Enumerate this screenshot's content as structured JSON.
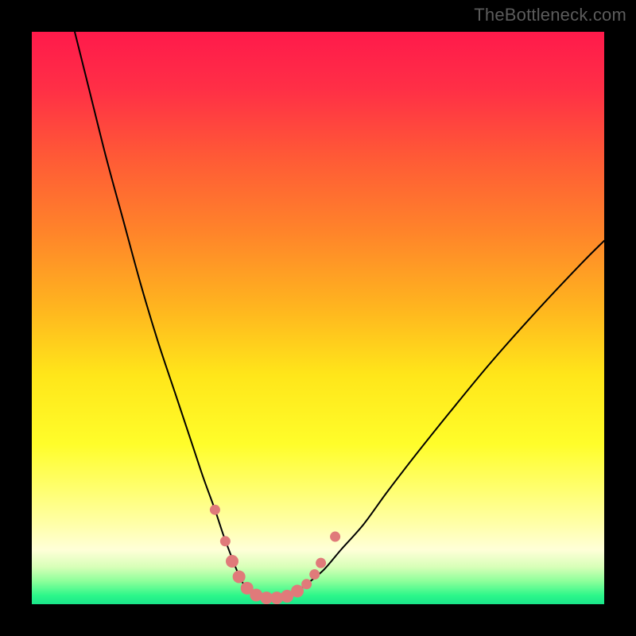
{
  "watermark": "TheBottleneck.com",
  "gradient": {
    "stops": [
      {
        "offset": 0.0,
        "color": "#ff1a4b"
      },
      {
        "offset": 0.1,
        "color": "#ff2f46"
      },
      {
        "offset": 0.22,
        "color": "#ff5a36"
      },
      {
        "offset": 0.35,
        "color": "#ff842a"
      },
      {
        "offset": 0.48,
        "color": "#ffb41f"
      },
      {
        "offset": 0.6,
        "color": "#ffe61a"
      },
      {
        "offset": 0.72,
        "color": "#fffd2a"
      },
      {
        "offset": 0.8,
        "color": "#ffff70"
      },
      {
        "offset": 0.86,
        "color": "#ffffa8"
      },
      {
        "offset": 0.905,
        "color": "#ffffd8"
      },
      {
        "offset": 0.935,
        "color": "#d8ffb8"
      },
      {
        "offset": 0.96,
        "color": "#8cff9a"
      },
      {
        "offset": 0.985,
        "color": "#2cf78a"
      },
      {
        "offset": 1.0,
        "color": "#1ae58a"
      }
    ]
  },
  "chart_data": {
    "type": "line",
    "title": "",
    "xlabel": "",
    "ylabel": "",
    "xlim": [
      0,
      100
    ],
    "ylim": [
      0,
      100
    ],
    "series": [
      {
        "name": "bottleneck-curve",
        "color": "#000000",
        "stroke_width": 2,
        "x": [
          7.5,
          10,
          13,
          16,
          19,
          22,
          25,
          28,
          30,
          32,
          33.5,
          35,
          36,
          37,
          38.5,
          40,
          42,
          44,
          46,
          48,
          51,
          54,
          58,
          62,
          67,
          73,
          80,
          88,
          96,
          100
        ],
        "y": [
          100,
          90,
          78,
          67,
          56,
          46,
          37,
          28,
          22,
          16.5,
          12,
          8,
          5.5,
          3.5,
          2,
          1.2,
          1,
          1.2,
          2,
          3.5,
          6,
          9.5,
          14,
          19.5,
          26,
          33.5,
          42,
          51,
          59.5,
          63.5
        ]
      }
    ],
    "markers": {
      "name": "valley-points",
      "color": "#e07a7a",
      "radius_small": 6.5,
      "radius_large": 8,
      "points": [
        {
          "x": 32.0,
          "y": 16.5,
          "r": "small"
        },
        {
          "x": 33.8,
          "y": 11.0,
          "r": "small"
        },
        {
          "x": 35.0,
          "y": 7.5,
          "r": "large"
        },
        {
          "x": 36.2,
          "y": 4.8,
          "r": "large"
        },
        {
          "x": 37.6,
          "y": 2.8,
          "r": "large"
        },
        {
          "x": 39.2,
          "y": 1.6,
          "r": "large"
        },
        {
          "x": 41.0,
          "y": 1.1,
          "r": "large"
        },
        {
          "x": 42.8,
          "y": 1.1,
          "r": "large"
        },
        {
          "x": 44.6,
          "y": 1.4,
          "r": "large"
        },
        {
          "x": 46.4,
          "y": 2.3,
          "r": "large"
        },
        {
          "x": 48.0,
          "y": 3.5,
          "r": "small"
        },
        {
          "x": 49.4,
          "y": 5.2,
          "r": "small"
        },
        {
          "x": 50.5,
          "y": 7.2,
          "r": "small"
        },
        {
          "x": 53.0,
          "y": 11.8,
          "r": "small"
        }
      ]
    }
  }
}
